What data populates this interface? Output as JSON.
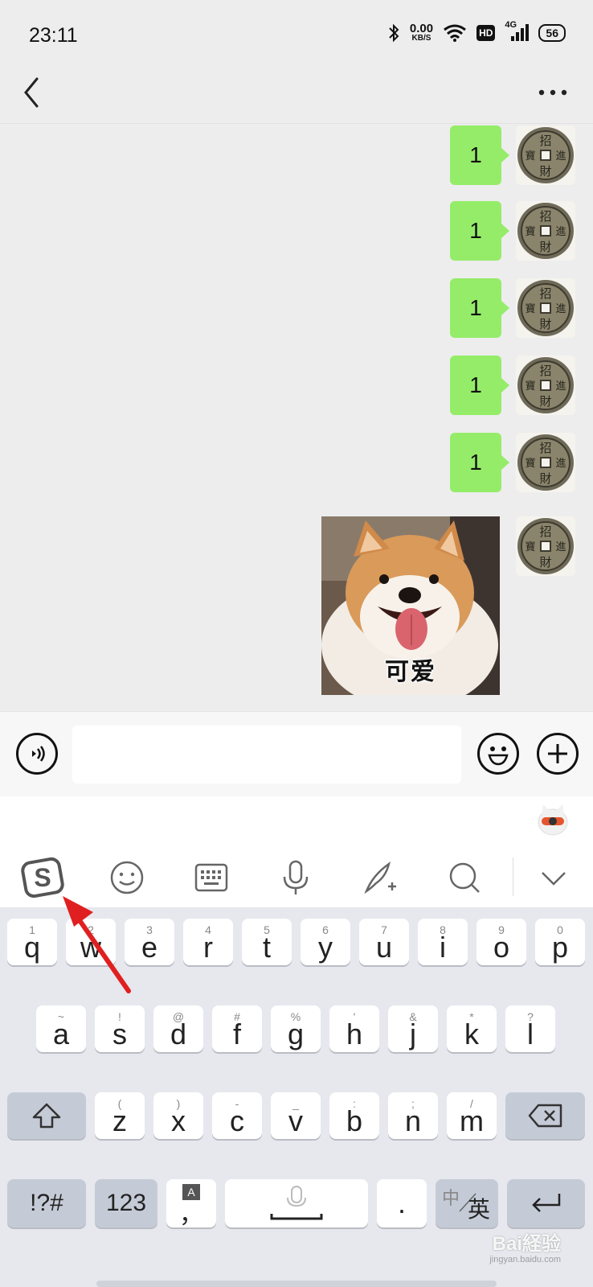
{
  "status_bar": {
    "time": "23:11",
    "net_speed_value": "0.00",
    "net_speed_unit": "KB/S",
    "hd_label": "HD",
    "signal_label": "4G",
    "battery_level": "56",
    "icons": [
      "bluetooth-icon",
      "wifi-icon",
      "hd-icon",
      "signal-icon",
      "battery-icon"
    ]
  },
  "header": {
    "back_icon": "chevron-left-icon",
    "more_icon": "more-dots-icon"
  },
  "messages": [
    {
      "sender": "self",
      "type": "text",
      "text": "1"
    },
    {
      "sender": "self",
      "type": "text",
      "text": "1"
    },
    {
      "sender": "self",
      "type": "text",
      "text": "1"
    },
    {
      "sender": "self",
      "type": "text",
      "text": "1"
    },
    {
      "sender": "self",
      "type": "text",
      "text": "1"
    },
    {
      "sender": "self",
      "type": "sticker",
      "caption": "可爱"
    }
  ],
  "avatar": {
    "coin_chars": [
      "招",
      "進",
      "財",
      "寶"
    ]
  },
  "input_bar": {
    "voice_icon": "voice-icon",
    "emoji_icon": "emoji-icon",
    "plus_icon": "plus-icon",
    "value": ""
  },
  "keyboard": {
    "toolbar": [
      "sogou-logo-icon",
      "emoji-face-icon",
      "keyboard-icon",
      "microphone-icon",
      "handwriting-icon",
      "search-icon",
      "collapse-chevron-icon"
    ],
    "row1": [
      {
        "hint": "1",
        "char": "q"
      },
      {
        "hint": "2",
        "char": "w"
      },
      {
        "hint": "3",
        "char": "e"
      },
      {
        "hint": "4",
        "char": "r"
      },
      {
        "hint": "5",
        "char": "t"
      },
      {
        "hint": "6",
        "char": "y"
      },
      {
        "hint": "7",
        "char": "u"
      },
      {
        "hint": "8",
        "char": "i"
      },
      {
        "hint": "9",
        "char": "o"
      },
      {
        "hint": "0",
        "char": "p"
      }
    ],
    "row2": [
      {
        "hint": "~",
        "char": "a"
      },
      {
        "hint": "!",
        "char": "s"
      },
      {
        "hint": "@",
        "char": "d"
      },
      {
        "hint": "#",
        "char": "f"
      },
      {
        "hint": "%",
        "char": "g"
      },
      {
        "hint": "'",
        "char": "h"
      },
      {
        "hint": "&",
        "char": "j"
      },
      {
        "hint": "*",
        "char": "k"
      },
      {
        "hint": "?",
        "char": "l"
      }
    ],
    "row3": [
      {
        "hint": "(",
        "char": "z"
      },
      {
        "hint": ")",
        "char": "x"
      },
      {
        "hint": "-",
        "char": "c"
      },
      {
        "hint": "_",
        "char": "v"
      },
      {
        "hint": ":",
        "char": "b"
      },
      {
        "hint": ";",
        "char": "n"
      },
      {
        "hint": "/",
        "char": "m"
      }
    ],
    "symbols_label": "!?#",
    "numbers_label": "123",
    "comma_label": "，",
    "comma_hint": "A",
    "period_label": ".",
    "lang_top": "中",
    "lang_bottom": "英"
  },
  "watermark": {
    "text": "Bai経验",
    "url": "jingyan.baidu.com"
  },
  "colors": {
    "bubble": "#95ec69",
    "chat_bg": "#ededed",
    "keyboard_bg": "#e6e8ee",
    "arrow": "#e02020"
  }
}
